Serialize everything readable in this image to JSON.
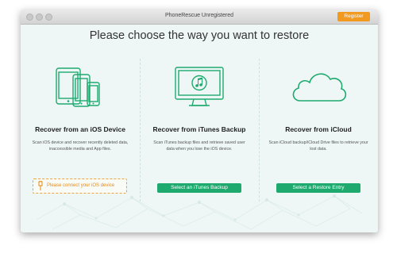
{
  "window": {
    "title": "PhoneRescue Unregistered",
    "register_label": "Register"
  },
  "main": {
    "heading": "Please choose the way you want to restore"
  },
  "options": [
    {
      "title": "Recover from an iOS Device",
      "description": "Scan iOS device and recover recently deleted data, inaccessible media and App files.",
      "action_label": "Please connect your iOS device",
      "illustration": "iphone-ipad-devices-icon"
    },
    {
      "title": "Recover from iTunes Backup",
      "description": "Scan iTunes backup files and retrieve saved user data when you lose the iOS device.",
      "action_label": "Select an iTunes Backup",
      "illustration": "itunes-monitor-icon"
    },
    {
      "title": "Recover from iCloud",
      "description": "Scan iCloud backup/iCloud Drive files to retrieve your lost data.",
      "action_label": "Select a Restore Entry",
      "illustration": "cloud-icon"
    }
  ],
  "colors": {
    "accent_green": "#1eaa6f",
    "warning_orange": "#f29a1f",
    "background": "#eef7f6"
  }
}
